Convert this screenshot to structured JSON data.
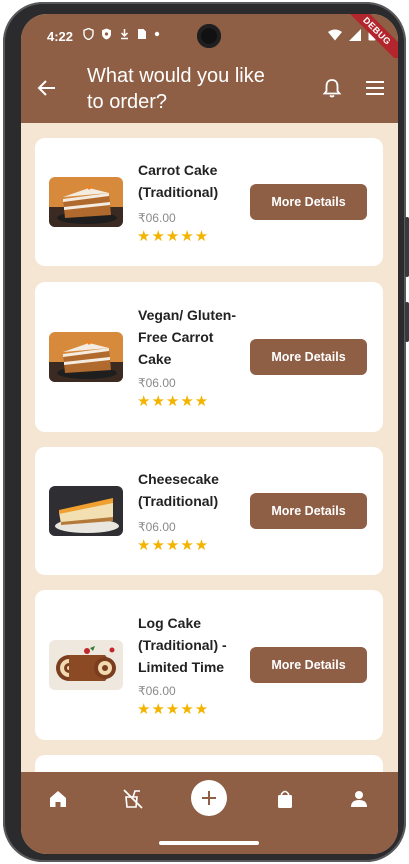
{
  "status_bar": {
    "time": "4:22",
    "left_icons": [
      "shield-icon",
      "shield-filled-icon",
      "download-icon",
      "sim-icon",
      "dot-icon"
    ],
    "right_icons": [
      "wifi-icon",
      "signal-icon",
      "battery-icon"
    ],
    "debug_banner": "DEBUG"
  },
  "app_bar": {
    "title": "What would you like to order?",
    "back_icon": "back-arrow-icon",
    "bell_icon": "bell-icon",
    "menu_icon": "hamburger-menu-icon"
  },
  "products": [
    {
      "name": "Carrot Cake (Traditional)",
      "price": "₹06.00",
      "rating": 5,
      "stars": "★★★★★",
      "button_label": "More Details",
      "image": "carrot-cake-image"
    },
    {
      "name": "Vegan/ Gluten-Free Carrot Cake",
      "price": "₹06.00",
      "rating": 5,
      "stars": "★★★★★",
      "button_label": "More Details",
      "image": "carrot-cake-image"
    },
    {
      "name": "Cheesecake (Traditional)",
      "price": "₹06.00",
      "rating": 5,
      "stars": "★★★★★",
      "button_label": "More Details",
      "image": "cheesecake-image"
    },
    {
      "name": "Log Cake (Traditional) - Limited Time",
      "price": "₹06.00",
      "rating": 5,
      "stars": "★★★★★",
      "button_label": "More Details",
      "image": "log-cake-image"
    }
  ],
  "bottom_nav": {
    "items": [
      "home-icon",
      "no-food-icon",
      "add-icon",
      "shopping-bag-icon",
      "person-icon"
    ],
    "active": "home-icon"
  },
  "colors": {
    "brand": "#8e5f45",
    "background": "#f5e6d4",
    "star": "#f3b400",
    "card": "#ffffff"
  }
}
